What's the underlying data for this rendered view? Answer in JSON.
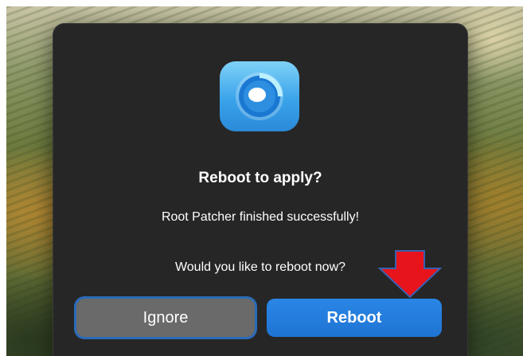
{
  "dialog": {
    "title": "Reboot to apply?",
    "message_line1": "Root Patcher finished successfully!",
    "message_line2": "Would you like to reboot now?",
    "app_icon": "opencore-patcher-icon"
  },
  "buttons": {
    "ignore_label": "Ignore",
    "reboot_label": "Reboot"
  },
  "annotation": {
    "icon": "red-down-arrow",
    "color": "#e8141c"
  },
  "colors": {
    "dialog_bg": "#262626",
    "primary_button": "#1f74d3",
    "secondary_button": "#6a6a6a",
    "focus_ring": "#2a6bb8"
  }
}
